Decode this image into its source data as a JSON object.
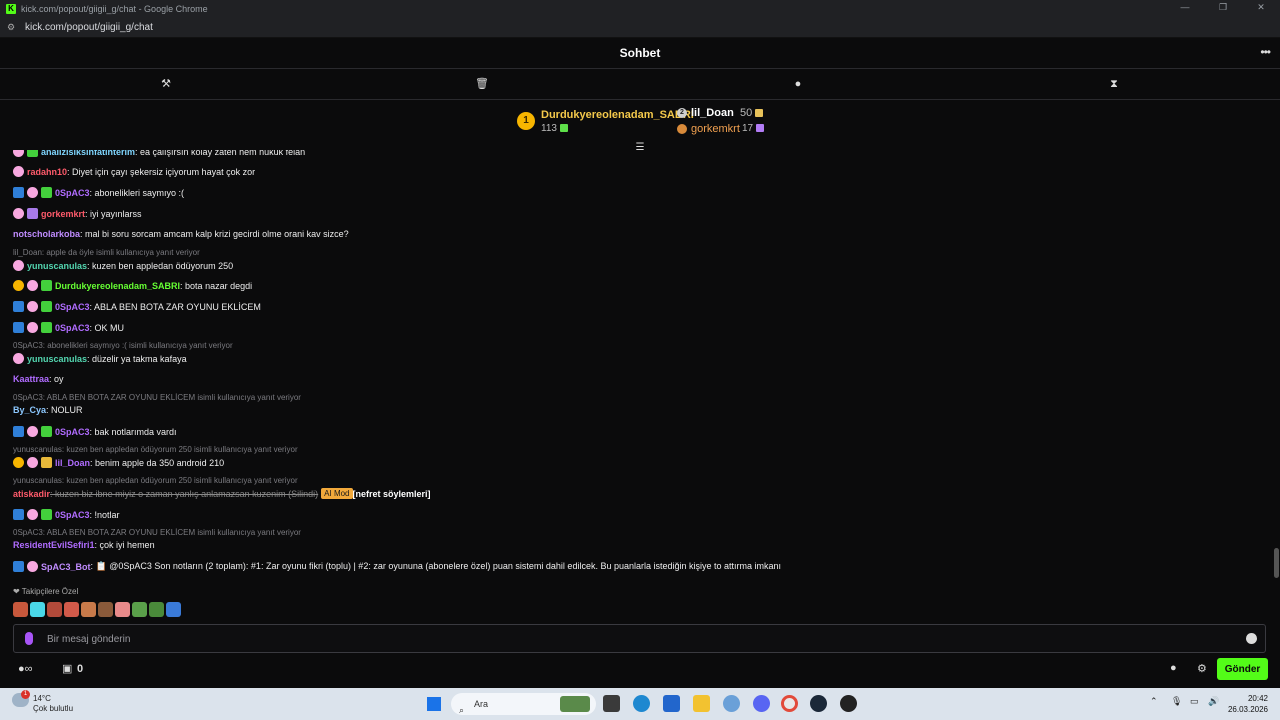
{
  "browser": {
    "window_title": "kick.com/popout/giigii_g/chat - Google Chrome",
    "url": "kick.com/popout/giigii_g/chat",
    "logo_letter": "K"
  },
  "chat": {
    "title": "Sohbet",
    "tools": [
      "hammer-icon",
      "trash-icon",
      "speech-bubble-icon",
      "hourglass-icon"
    ]
  },
  "leaderboard": {
    "first": {
      "rank": "1",
      "name": "Durdukyereolenadam_SABRI",
      "count": "113"
    },
    "second": {
      "name": "lil_Doan",
      "count": "50"
    },
    "third": {
      "name": "gorkemkrt",
      "count": "17"
    }
  },
  "messages": [
    {
      "user": "analizisiksinfatihterim",
      "text": ": ea çalışırsın kolay zaten hem hukuk felan",
      "color": "#7fd6ff",
      "badges": [
        "pink",
        "green"
      ]
    },
    {
      "user": "radahn10",
      "text": ": Diyet için çayı şekersiz içiyorum hayat çok zor",
      "color": "#ff5b6b",
      "badges": [
        "pink"
      ]
    },
    {
      "user": "0SpAC3",
      "text": ": abonelikleri saymıyo :(",
      "color": "#b06cff",
      "badges": [
        "blue",
        "pink",
        "green"
      ]
    },
    {
      "user": "gorkemkrt",
      "text": ": iyi yayınlarss",
      "color": "#ff5b6b",
      "badges": [
        "pink",
        "purple"
      ]
    },
    {
      "user": "notscholarkoba",
      "text": ": mal bi soru sorcam amcam kalp krizi gecirdi olme orani kav sizce?",
      "color": "#c08cff",
      "badges": []
    },
    {
      "reply": "lil_Doan: apple da öyle isimli kullanıcıya yanıt veriyor"
    },
    {
      "user": "yunuscanulas",
      "text": ": kuzen ben appledan ödüyorum 250",
      "color": "#53d6b0",
      "badges": [
        "pink"
      ]
    },
    {
      "user": "Durdukyereolenadam_SABRI",
      "text": ": bota nazar degdi",
      "color": "#66ff33",
      "badges": [
        "gold",
        "pink",
        "green"
      ]
    },
    {
      "user": "0SpAC3",
      "text": ": ABLA BEN BOTA ZAR OYUNU EKLİCEM",
      "color": "#b06cff",
      "badges": [
        "blue",
        "pink",
        "green"
      ]
    },
    {
      "user": "0SpAC3",
      "text": ": OK MU",
      "color": "#b06cff",
      "badges": [
        "blue",
        "pink",
        "green"
      ]
    },
    {
      "reply": "0SpAC3: abonelikleri saymıyo :( isimli kullanıcıya yanıt veriyor"
    },
    {
      "user": "yunuscanulas",
      "text": ": düzelir ya takma kafaya",
      "color": "#53d6b0",
      "badges": [
        "pink"
      ]
    },
    {
      "user": "Kaattraa",
      "text": ": oy",
      "color": "#b06cff",
      "badges": []
    },
    {
      "reply": "0SpAC3: ABLA BEN BOTA ZAR OYUNU EKLİCEM isimli kullanıcıya yanıt veriyor"
    },
    {
      "user": "By_Cya",
      "text": ": NOLUR",
      "color": "#8cc8ff",
      "badges": []
    },
    {
      "user": "0SpAC3",
      "text": ": bak notlarımda vardı",
      "color": "#b06cff",
      "badges": [
        "blue",
        "pink",
        "green"
      ]
    },
    {
      "reply": "yunuscanulas: kuzen ben appledan ödüyorum 250 isimli kullanıcıya yanıt veriyor"
    },
    {
      "user": "lil_Doan",
      "text": ": benim apple da 350 android 210",
      "color": "#b06cff",
      "badges": [
        "gold",
        "pink",
        "yellow"
      ]
    },
    {
      "reply": "yunuscanulas: kuzen ben appledan ödüyorum 250 isimli kullanıcıya yanıt veriyor"
    },
    {
      "user": "atiskadir",
      "text": ": kuzen biz ibne miyiz o zaman yanlış anlamazsan kuzenim (Silindi)",
      "color": "#ff5b6b",
      "badges": [],
      "deleted": true,
      "tag": "AI Mod",
      "suffix": " [nefret söylemleri]"
    },
    {
      "user": "0SpAC3",
      "text": ": !notlar",
      "color": "#b06cff",
      "badges": [
        "blue",
        "pink",
        "green"
      ]
    },
    {
      "reply": "0SpAC3: ABLA BEN BOTA ZAR OYUNU EKLİCEM isimli kullanıcıya yanıt veriyor"
    },
    {
      "user": "ResidentEvilSefiri1",
      "text": ": çok iyi hemen",
      "color": "#b06cff",
      "badges": []
    },
    {
      "user": "SpAC3_Bot",
      "text": ": 📋 @0SpAC3 Son notların (2 toplam): #1: Zar oyunu fikri (toplu) | #2: zar oyununa (abonelere özel) puan sistemi dahil edilcek. Bu puanlarla istediğin kişiye to attırma imkanı",
      "color": "#c08cff",
      "badges": [
        "blue",
        "pink"
      ]
    }
  ],
  "followers_label": "❤ Takipçilere Özel",
  "emote_colors": [
    "#c8583c",
    "#4ad8e8",
    "#b24a3a",
    "#d25a4a",
    "#c87a4a",
    "#8a5a3a",
    "#e88a8a",
    "#5aa04a",
    "#4a8a3a",
    "#3a7ad8"
  ],
  "input": {
    "placeholder": "Bir mesaj gönderin"
  },
  "bottom": {
    "gift_count": "0",
    "send_label": "Gönder"
  },
  "taskbar": {
    "temp": "14°C",
    "weather": "Çok bulutlu",
    "alert": "1",
    "search_label": "Ara",
    "time": "20:42",
    "date": "26.03.2026"
  }
}
